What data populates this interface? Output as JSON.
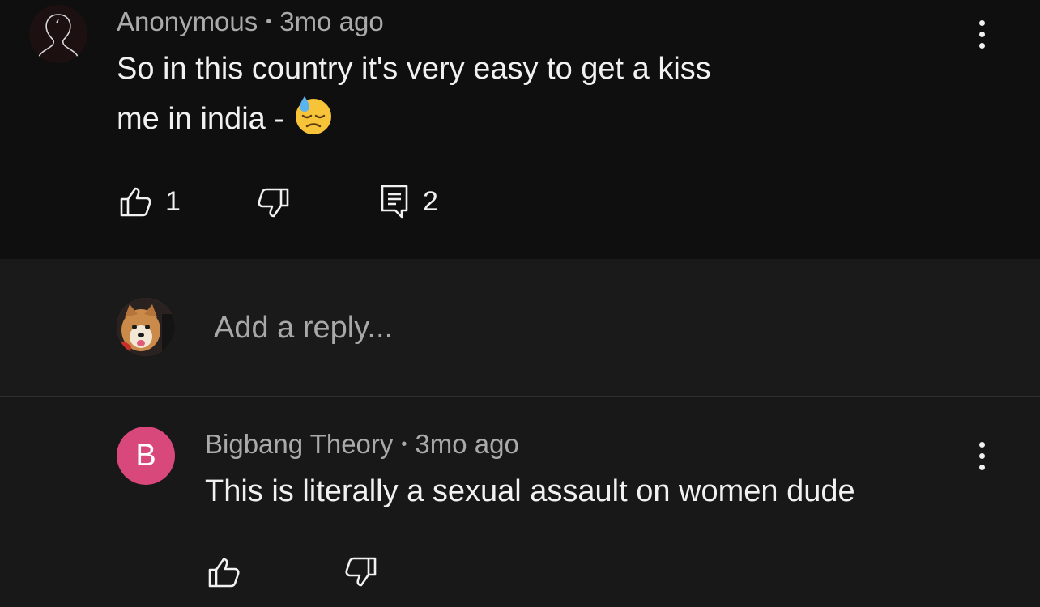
{
  "colors": {
    "top_bg": "#0f0f0f",
    "reply_bg": "#1a1a1a",
    "meta": "#aaaaaa",
    "text": "#f1f1f1",
    "avatar_b": "#d9487a"
  },
  "comment1": {
    "author": "Anonymous",
    "separator": "•",
    "time": "3mo ago",
    "line1": "So in this country it's very easy to get a kiss",
    "line2": "me in india - ",
    "emoji": "😓",
    "likes": "1",
    "replies": "2",
    "icons": [
      "more-vert-icon",
      "thumb-up-icon",
      "thumb-down-icon",
      "comment-icon"
    ]
  },
  "reply": {
    "placeholder": "Add a reply..."
  },
  "comment2": {
    "avatar_letter": "B",
    "author": "Bigbang Theory",
    "separator": "•",
    "time": "3mo ago",
    "text": "This is literally a sexual assault on women dude",
    "icons": [
      "more-vert-icon",
      "thumb-up-icon",
      "thumb-down-icon"
    ]
  }
}
